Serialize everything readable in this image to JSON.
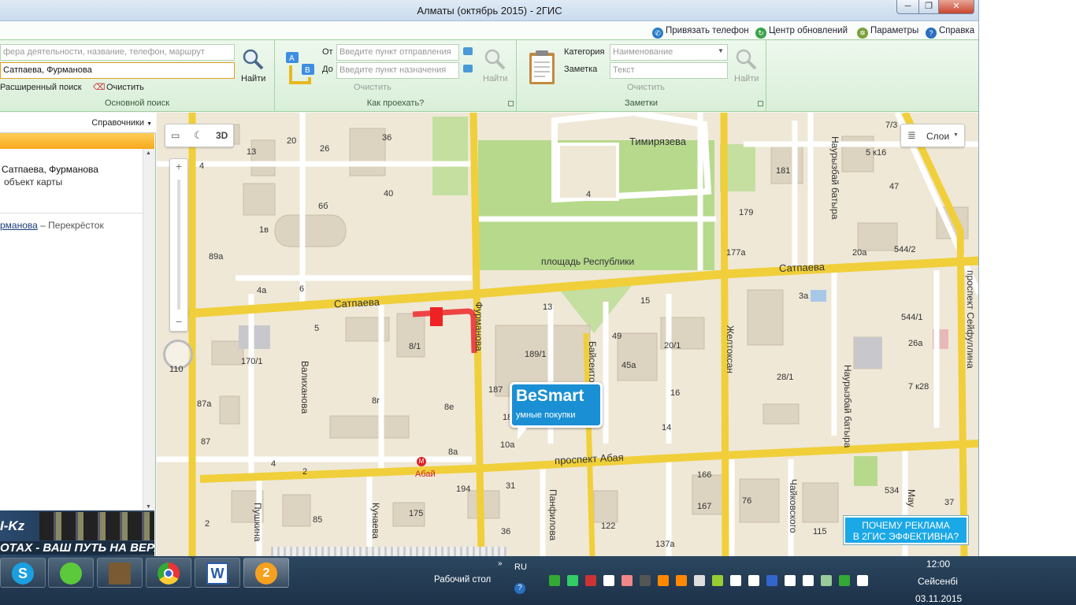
{
  "window": {
    "title": "Алматы (октябрь 2015) - 2ГИС",
    "min": "─",
    "max": "❐",
    "close": "✕"
  },
  "menu": {
    "bind_phone": "Привязать телефон",
    "update_center": "Центр обновлений",
    "settings": "Параметры",
    "help": "Справка"
  },
  "ribbon": {
    "main_search": {
      "placeholder": "фера деятельности, название, телефон, маршрут",
      "value": "Сатпаева, Фурманова",
      "find": "Найти",
      "advanced": "Расширенный поиск",
      "clear": "Очистить",
      "label": "Основной поиск"
    },
    "route": {
      "from_label": "От",
      "to_label": "До",
      "from_placeholder": "Введите пункт отправления",
      "to_placeholder": "Введите пункт назначения",
      "clear": "Очистить",
      "find": "Найти",
      "label": "Как проехать?"
    },
    "notes": {
      "category_label": "Категория",
      "note_label": "Заметка",
      "category_placeholder": "Наименование",
      "note_placeholder": "Текст",
      "clear": "Очистить",
      "find": "Найти",
      "label": "Заметки"
    }
  },
  "left_panel": {
    "directories": "Справочники",
    "result_title": "Сатпаева, Фурманова",
    "result_sub": "объект карты",
    "item_link": "рманова",
    "item_rest": "– Перекрёсток",
    "ad_text": "ОТАХ - ВАШ ПУТЬ НА ВЕРХ!",
    "ad_brand": "I-Kz"
  },
  "map": {
    "tool_3d": "3D",
    "layers": "Слои",
    "scale_label": "110",
    "streets": {
      "timiryazeva": "Тимирязева",
      "satpaeva_left": "Сатпаева",
      "satpaeva_right": "Сатпаева",
      "abaya": "проспект Абая",
      "furmanova": "Фурманова",
      "baiseitovoy": "Байсеитовой",
      "zheltoksan": "Желтоксан",
      "nauryzbai1": "Наурызбай батыра",
      "nauryzbai2": "Наурызбай батыра",
      "seifullina": "проспект Сейфуллина",
      "valihanova": "Валиханова",
      "pushkina": "Пушкина",
      "kunaeva": "Кунаева",
      "panfilova": "Панфилова",
      "chaikovskogo": "Чайковского",
      "maul": "Мау",
      "republic_square": "площадь Республики",
      "abai_metro": "Абай"
    },
    "house_numbers": [
      "13",
      "20",
      "26",
      "36",
      "4",
      "40",
      "6б",
      "1в",
      "89а",
      "4а",
      "6",
      "5",
      "8/1",
      "170/1",
      "87а",
      "87",
      "8г",
      "8е",
      "8а",
      "4",
      "2",
      "10а",
      "187",
      "187",
      "189/1",
      "13",
      "15",
      "20/1",
      "49",
      "45а",
      "16",
      "14",
      "4",
      "179",
      "181",
      "177а",
      "3а",
      "20а",
      "544/2",
      "544/1",
      "26а",
      "28/1",
      "7 к28",
      "5 к16",
      "7/3",
      "47",
      "166",
      "167",
      "76",
      "115",
      "534",
      "37",
      "31",
      "194",
      "175",
      "36",
      "122",
      "137а",
      "85",
      "2"
    ],
    "besmart_title": "BeSmart",
    "besmart_sub": "умные покупки",
    "ad_line1": "ПОЧЕМУ РЕКЛАМА",
    "ad_line2": "В 2ГИС ЭФФЕКТИВНА?"
  },
  "taskbar": {
    "desktop": "Рабочий стол",
    "lang": "RU",
    "time": "12:00",
    "day": "Сейсенбі",
    "date": "03.11.2015"
  },
  "colors": {
    "ribbon_bg": "#e3f3e3",
    "orange": "#f7a81c",
    "road_yellow": "#f3d84a",
    "park_green": "#b7d98a",
    "besmart_blue": "#1a8fd4"
  }
}
